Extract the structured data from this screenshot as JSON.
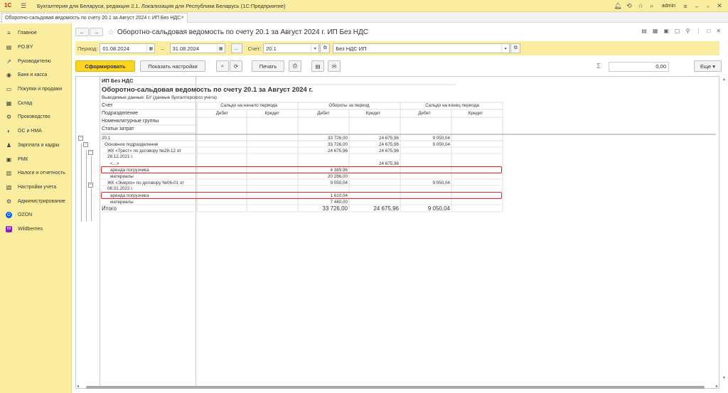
{
  "app": {
    "title": "Бухгалтерия для Беларуси, редакция 2.1. Локализация для Республики Беларусь   (1С:Предприятие)",
    "logo": "1С",
    "user": "admin"
  },
  "tab": {
    "label": "Оборотно-сальдовая ведомость по счету 20.1 за Август 2024 г. ИП Без НДС"
  },
  "sidebar": {
    "items": [
      {
        "label": "Главное",
        "icon": "menu-icon"
      },
      {
        "label": "PO.BY",
        "icon": "list-icon"
      },
      {
        "label": "Руководителю",
        "icon": "trend-icon"
      },
      {
        "label": "Банк и касса",
        "icon": "bank-icon"
      },
      {
        "label": "Покупки и продажи",
        "icon": "cart-icon"
      },
      {
        "label": "Склад",
        "icon": "warehouse-icon"
      },
      {
        "label": "Производство",
        "icon": "factory-icon"
      },
      {
        "label": "ОС и НМА",
        "icon": "car-icon"
      },
      {
        "label": "Зарплата и кадры",
        "icon": "people-icon"
      },
      {
        "label": "РМК",
        "icon": "register-icon"
      },
      {
        "label": "Налоги и отчетность",
        "icon": "report-icon"
      },
      {
        "label": "Настройки учета",
        "icon": "settings-doc-icon"
      },
      {
        "label": "Администрирование",
        "icon": "gear-icon"
      },
      {
        "label": "OZON",
        "icon": "ozon-icon"
      },
      {
        "label": "Wildberries",
        "icon": "wildberries-icon"
      }
    ]
  },
  "header": {
    "title": "Оборотно-сальдовая ведомость по счету 20.1 за Август 2024 г. ИП Без НДС"
  },
  "filters": {
    "period_label": "Период:",
    "date_from": "01.08.2024",
    "dash": "–",
    "date_to": "31.08.2024",
    "ellipsis": "...",
    "account_label": "Счет:",
    "account": "20.1",
    "org": "Без НДС ИП"
  },
  "toolbar": {
    "generate": "Сформировать",
    "settings": "Показать настройки",
    "print": "Печать",
    "sum_symbol": "Σ",
    "sum_value": "0,00",
    "more": "Еще"
  },
  "report": {
    "org": "ИП Без НДС",
    "title": "Оборотно-сальдовая ведомость по счету 20.1 за Август 2024 г.",
    "data_label": "Выводимые данные:  БУ (данные бухгалтерского учета)",
    "col_headers": {
      "account": "Счет",
      "division": "Подразделение",
      "nomenclature": "Номенклатурные группы",
      "cost_items": "Статьи затрат",
      "opening": "Сальдо на начало периода",
      "turnover": "Обороты за период",
      "closing": "Сальдо на конец периода",
      "debit": "Дебет",
      "credit": "Кредит"
    },
    "rows": [
      {
        "label": "20.1",
        "td": "33 726,00",
        "tc": "24 675,96",
        "cd": "9 050,04"
      },
      {
        "label": "Основное подразделение",
        "td": "33 726,00",
        "tc": "24 675,96",
        "cd": "9 050,04"
      },
      {
        "label": "ЖК «Трест» по договору №28-12 от",
        "label2": "28.12.2021 г.",
        "td": "24 675,96",
        "tc": "24 675,96"
      },
      {
        "label": "<...>",
        "tc": "24 675,96"
      },
      {
        "label": "аренда погрузчика",
        "td": "4 389,96"
      },
      {
        "label": "материалы",
        "td": "20 286,00"
      },
      {
        "label": "ЖК «Энерго» по договору №06-01 от",
        "label2": "06.01.2022 г.",
        "td": "9 050,04",
        "cd": "9 050,04"
      },
      {
        "label": "аренда погрузчика",
        "td": "1 610,04"
      },
      {
        "label": "материалы",
        "td": "7 440,00"
      }
    ],
    "total": {
      "label": "Итого",
      "td": "33 726,00",
      "tc": "24 675,96",
      "cd": "9 050,04"
    }
  },
  "colors": {
    "accent_yellow": "#fbeda0",
    "button_yellow": "#fbd521",
    "highlight_red": "#e0272a"
  }
}
